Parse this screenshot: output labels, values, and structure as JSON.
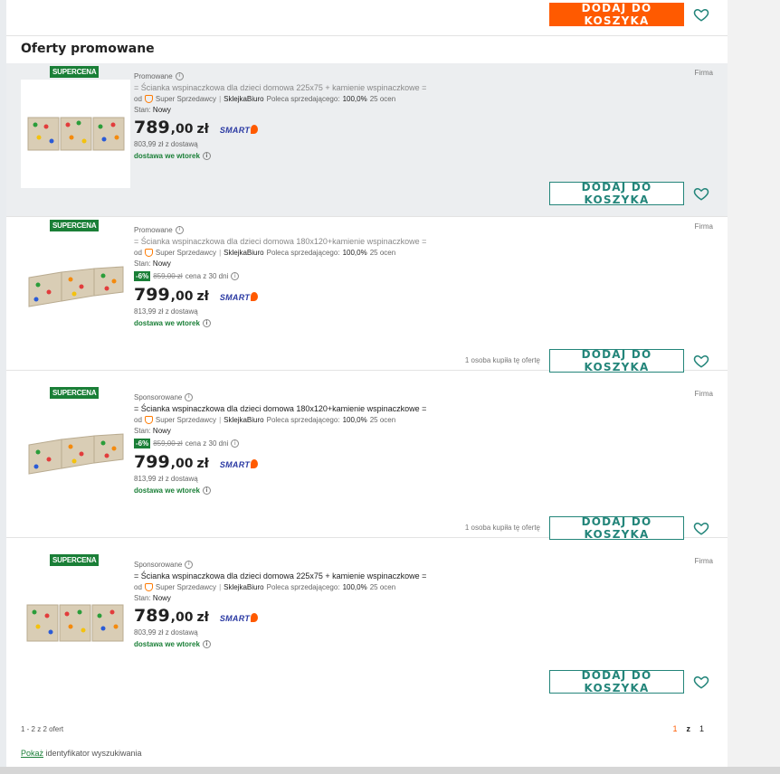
{
  "top": {
    "add_to_cart": "DODAJ DO KOSZYKA"
  },
  "section_title": "Oferty promowane",
  "offers": [
    {
      "badge": "SUPERCENA",
      "seller_type": "Firma",
      "promo_label": "Promowane",
      "title": "= Ścianka wspinaczkowa dla dzieci domowa 225x75 + kamienie wspinaczkowe =",
      "seller_prefix": "od",
      "seller_badge": "Super Sprzedawcy",
      "seller_name": "SklejkaBiuro",
      "recommend_label": "Poleca sprzedającego:",
      "recommend_value": "100,0%",
      "reviews": "25 ocen",
      "stan_label": "Stan:",
      "stan_value": "Nowy",
      "price_int": "789",
      "price_dec": ",00",
      "currency": "zł",
      "smart": "SMART",
      "delivery_cost": "803,99 zł z dostawą",
      "delivery": "dostawa we wtorek",
      "add_to_cart": "DODAJ DO KOSZYKA"
    },
    {
      "badge": "SUPERCENA",
      "seller_type": "Firma",
      "promo_label": "Promowane",
      "title": "= Ścianka wspinaczkowa dla dzieci domowa 180x120+kamienie wspinaczkowe =",
      "seller_prefix": "od",
      "seller_badge": "Super Sprzedawcy",
      "seller_name": "SklejkaBiuro",
      "recommend_label": "Poleca sprzedającego:",
      "recommend_value": "100,0%",
      "reviews": "25 ocen",
      "stan_label": "Stan:",
      "stan_value": "Nowy",
      "discount_badge": "-6%",
      "old_price": "859,00 zł",
      "old_price_note": "cena z 30 dni",
      "price_int": "799",
      "price_dec": ",00",
      "currency": "zł",
      "smart": "SMART",
      "delivery_cost": "813,99 zł z dostawą",
      "delivery": "dostawa we wtorek",
      "bought": "1 osoba kupiła tę ofertę",
      "add_to_cart": "DODAJ DO KOSZYKA"
    },
    {
      "badge": "SUPERCENA",
      "seller_type": "Firma",
      "promo_label": "Sponsorowane",
      "title": "= Ścianka wspinaczkowa dla dzieci domowa 180x120+kamienie wspinaczkowe =",
      "seller_prefix": "od",
      "seller_badge": "Super Sprzedawcy",
      "seller_name": "SklejkaBiuro",
      "recommend_label": "Poleca sprzedającego:",
      "recommend_value": "100,0%",
      "reviews": "25 ocen",
      "stan_label": "Stan:",
      "stan_value": "Nowy",
      "discount_badge": "-6%",
      "old_price": "859,00 zł",
      "old_price_note": "cena z 30 dni",
      "price_int": "799",
      "price_dec": ",00",
      "currency": "zł",
      "smart": "SMART",
      "delivery_cost": "813,99 zł z dostawą",
      "delivery": "dostawa we wtorek",
      "bought": "1 osoba kupiła tę ofertę",
      "add_to_cart": "DODAJ DO KOSZYKA"
    },
    {
      "badge": "SUPERCENA",
      "seller_type": "Firma",
      "promo_label": "Sponsorowane",
      "title": "= Ścianka wspinaczkowa dla dzieci domowa 225x75 + kamienie wspinaczkowe =",
      "seller_prefix": "od",
      "seller_badge": "Super Sprzedawcy",
      "seller_name": "SklejkaBiuro",
      "recommend_label": "Poleca sprzedającego:",
      "recommend_value": "100,0%",
      "reviews": "25 ocen",
      "stan_label": "Stan:",
      "stan_value": "Nowy",
      "price_int": "789",
      "price_dec": ",00",
      "currency": "zł",
      "smart": "SMART",
      "delivery_cost": "803,99 zł z dostawą",
      "delivery": "dostawa we wtorek",
      "add_to_cart": "DODAJ DO KOSZYKA"
    }
  ],
  "pagination": {
    "count": "1 - 2 z 2 ofert",
    "current": "1",
    "of": "z",
    "total": "1"
  },
  "footer": {
    "show_link": "Pokaż",
    "ident_text": " identyfikator wyszukiwania"
  },
  "colors": {
    "accent_orange": "#ff5a00",
    "teal": "#23857a",
    "green": "#1a7f37",
    "smart_blue": "#2b3aa3"
  }
}
